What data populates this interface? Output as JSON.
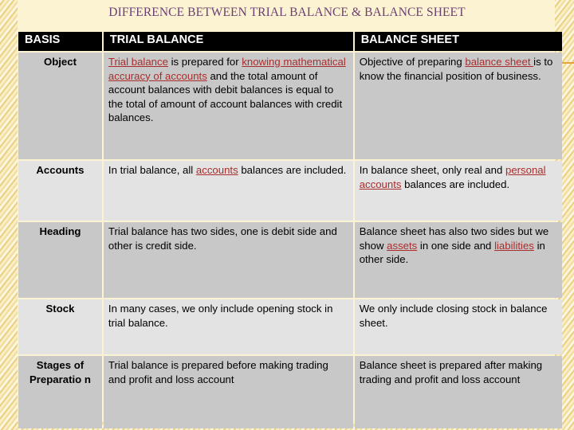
{
  "slide": {
    "title": "DIFFERENCE BETWEEN TRIAL BALANCE & BALANCE SHEET",
    "background_color": "#fcf3d2",
    "title_color": "#6b3f72",
    "highlight_color": "#a92d2d",
    "header_bg_color": "#000000",
    "header_text_color": "#ffffff",
    "row_shade_dark": "#c8c8c8",
    "row_shade_light": "#e3e3e3"
  },
  "table": {
    "headers": {
      "basis": "BASIS",
      "trial_balance": "TRIAL BALANCE",
      "balance_sheet": "BALANCE SHEET"
    },
    "rows": [
      {
        "basis": "Object",
        "trial_balance_parts": [
          {
            "text": " ",
            "highlight": false
          },
          {
            "text": "Trial balance",
            "highlight": true
          },
          {
            "text": " is prepared for ",
            "highlight": false
          },
          {
            "text": "knowing mathematical accuracy of accounts",
            "highlight": true
          },
          {
            "text": " and the total amount of account balances with debit balances is equal to the total of amount of account balances with credit balances.",
            "highlight": false
          }
        ],
        "balance_sheet_parts": [
          {
            "text": " Objective of preparing ",
            "highlight": false
          },
          {
            "text": "balance sheet ",
            "highlight": true
          },
          {
            "text": "is to know the financial position of business.",
            "highlight": false
          }
        ]
      },
      {
        "basis": "Accounts",
        "trial_balance_parts": [
          {
            "text": " In trial balance, all ",
            "highlight": false
          },
          {
            "text": "accounts",
            "highlight": true
          },
          {
            "text": " balances are included.",
            "highlight": false
          }
        ],
        "balance_sheet_parts": [
          {
            "text": " In balance sheet, only real and ",
            "highlight": false
          },
          {
            "text": "personal accounts",
            "highlight": true
          },
          {
            "text": " balances are included.",
            "highlight": false
          }
        ]
      },
      {
        "basis": "Heading",
        "trial_balance_parts": [
          {
            "text": " Trial balance has two sides, one is debit side and other is credit side.",
            "highlight": false
          }
        ],
        "balance_sheet_parts": [
          {
            "text": " Balance sheet has also two sides but we show ",
            "highlight": false
          },
          {
            "text": "assets",
            "highlight": true
          },
          {
            "text": " in one side and ",
            "highlight": false
          },
          {
            "text": "liabilities",
            "highlight": true
          },
          {
            "text": " in other side.",
            "highlight": false
          }
        ]
      },
      {
        "basis": "Stock",
        "trial_balance_parts": [
          {
            "text": " In many cases, we only include opening stock in trial balance.",
            "highlight": false
          }
        ],
        "balance_sheet_parts": [
          {
            "text": " We only include closing stock in balance sheet.",
            "highlight": false
          }
        ]
      },
      {
        "basis": "Stages of Preparatio n",
        "trial_balance_parts": [
          {
            "text": " Trial balance is prepared before making trading and profit and loss account",
            "highlight": false
          }
        ],
        "balance_sheet_parts": [
          {
            "text": " Balance sheet is prepared after making trading and profit and loss account",
            "highlight": false
          }
        ]
      }
    ]
  }
}
